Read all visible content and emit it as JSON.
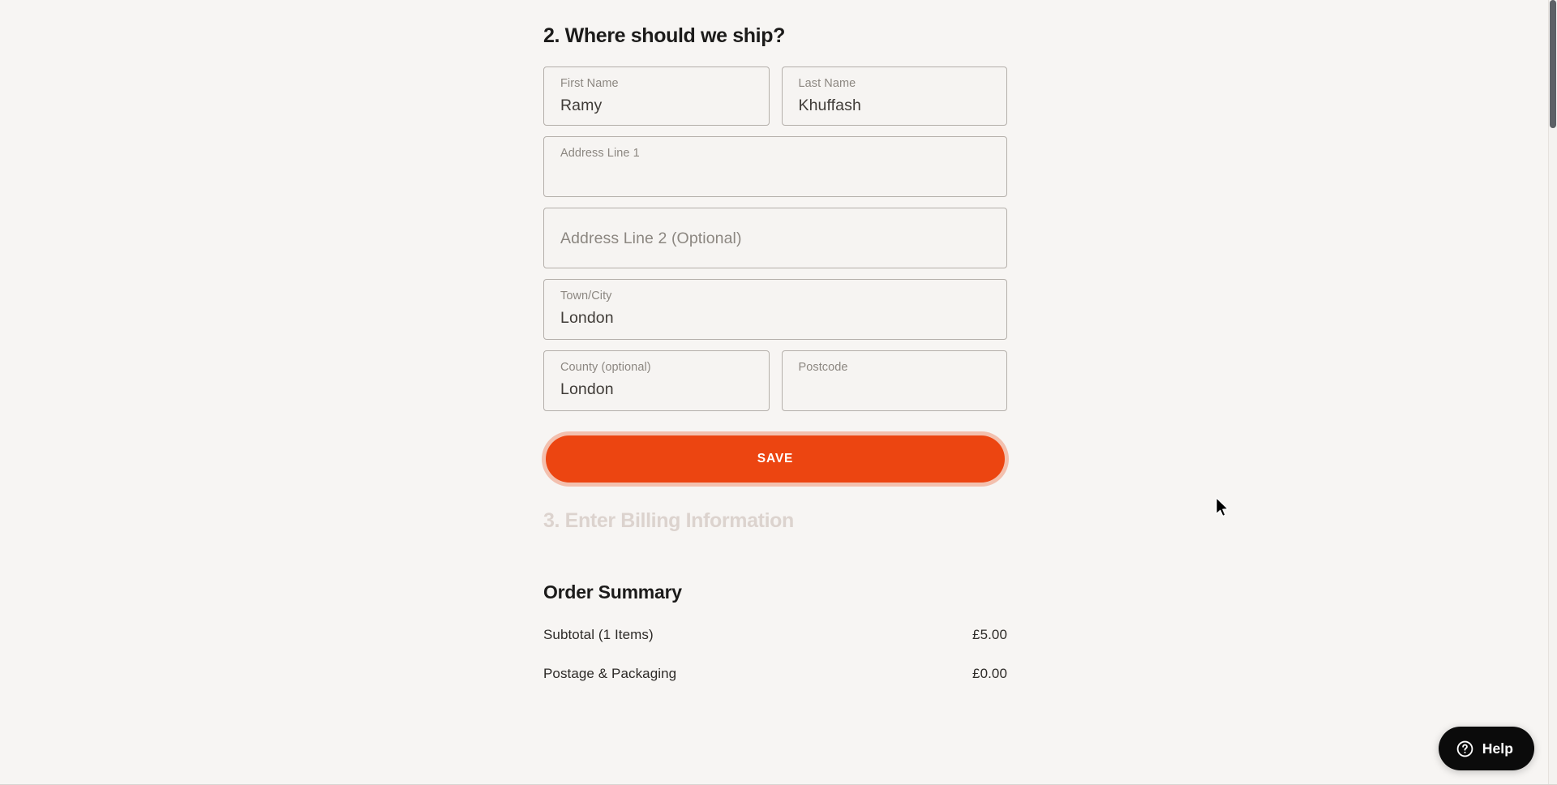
{
  "shipping": {
    "heading": "2. Where should we ship?",
    "fields": [
      {
        "name": "first-name",
        "label": "First Name",
        "value": "Ramy",
        "mode": "label"
      },
      {
        "name": "last-name",
        "label": "Last Name",
        "value": "Khuffash",
        "mode": "label"
      },
      {
        "name": "address-line-1",
        "label": "Address Line 1",
        "value": "",
        "mode": "label"
      },
      {
        "name": "address-line-2",
        "placeholder": "Address Line 2 (Optional)",
        "value": "",
        "mode": "placeholder"
      },
      {
        "name": "town-city",
        "label": "Town/City",
        "value": "London",
        "mode": "label"
      },
      {
        "name": "county",
        "label": "County (optional)",
        "value": "London",
        "mode": "label"
      },
      {
        "name": "postcode",
        "label": "Postcode",
        "value": "",
        "mode": "label"
      }
    ],
    "save_label": "SAVE"
  },
  "billing": {
    "heading": "3. Enter Billing Information"
  },
  "order_summary": {
    "title": "Order Summary",
    "rows": [
      {
        "label": "Subtotal (1 Items)",
        "amount": "£5.00"
      },
      {
        "label": "Postage & Packaging",
        "amount": "£0.00"
      }
    ]
  },
  "help_widget": {
    "label": "Help",
    "icon": "question-circle-icon"
  },
  "colors": {
    "page_background": "#F7F5F3",
    "accent_orange": "#EC4511",
    "field_border": "#B4AFAA",
    "label_grey": "#8C8781",
    "heading_dark": "#1C1B1A",
    "disabled_heading": "#DCD3CE",
    "help_black": "#0B0B0B"
  }
}
